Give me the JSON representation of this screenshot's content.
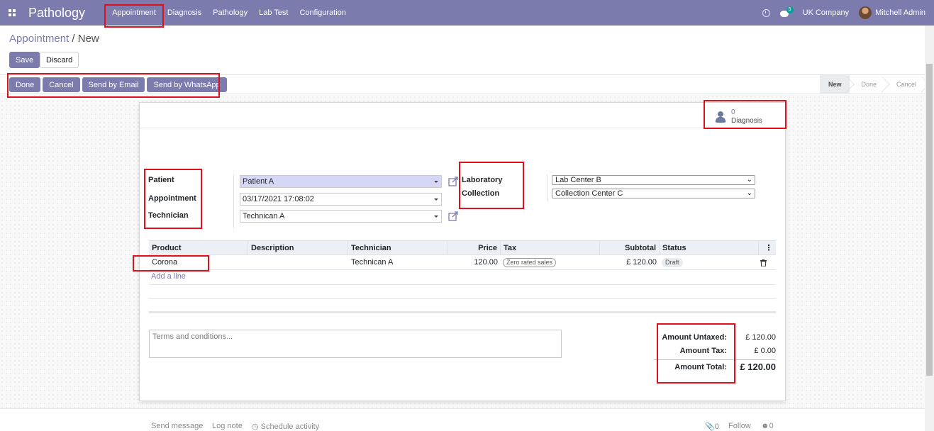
{
  "navbar": {
    "brand": "Pathology",
    "menu": [
      "Appointment",
      "Diagnosis",
      "Pathology",
      "Lab Test",
      "Configuration"
    ],
    "chat_count": "5",
    "company": "UK Company",
    "user": "Mitchell Admin"
  },
  "breadcrumb": {
    "parent": "Appointment",
    "separator": "/",
    "current": "New"
  },
  "buttons": {
    "save": "Save",
    "discard": "Discard"
  },
  "header_buttons": [
    "Done",
    "Cancel",
    "Send by Email",
    "Send by WhatsApp"
  ],
  "stages": [
    "New",
    "Done",
    "Cancel"
  ],
  "smart_button": {
    "count": "0",
    "label": "Diagnosis"
  },
  "form": {
    "patient_label": "Patient",
    "appointment_label": "Appointment",
    "technician_label": "Technician",
    "patient_value": "Patient A",
    "appointment_value": "03/17/2021 17:08:02",
    "technician_value": "Technican A",
    "laboratory_label": "Laboratory",
    "collection_label": "Collection",
    "laboratory_value": "Lab Center B",
    "collection_value": "Collection Center C"
  },
  "table": {
    "headers": [
      "Product",
      "Description",
      "Technician",
      "Price",
      "Tax",
      "Subtotal",
      "Status"
    ],
    "rows": [
      {
        "product": "Corona",
        "description": "",
        "technician": "Technican A",
        "price": "120.00",
        "tax": "Zero rated sales",
        "subtotal": "£ 120.00",
        "status": "Draft"
      }
    ],
    "add_line": "Add a line"
  },
  "terms_placeholder": "Terms and conditions...",
  "totals": {
    "untaxed_label": "Amount Untaxed:",
    "untaxed_value": "£ 120.00",
    "tax_label": "Amount Tax:",
    "tax_value": "£ 0.00",
    "total_label": "Amount Total:",
    "total_value": "£ 120.00"
  },
  "chatter": {
    "send_message": "Send message",
    "log_note": "Log note",
    "schedule_activity": "Schedule activity",
    "attachments": "0",
    "follow": "Follow",
    "followers": "0"
  },
  "colors": {
    "brand": "#7c7bad",
    "highlight": "#e0111b"
  }
}
